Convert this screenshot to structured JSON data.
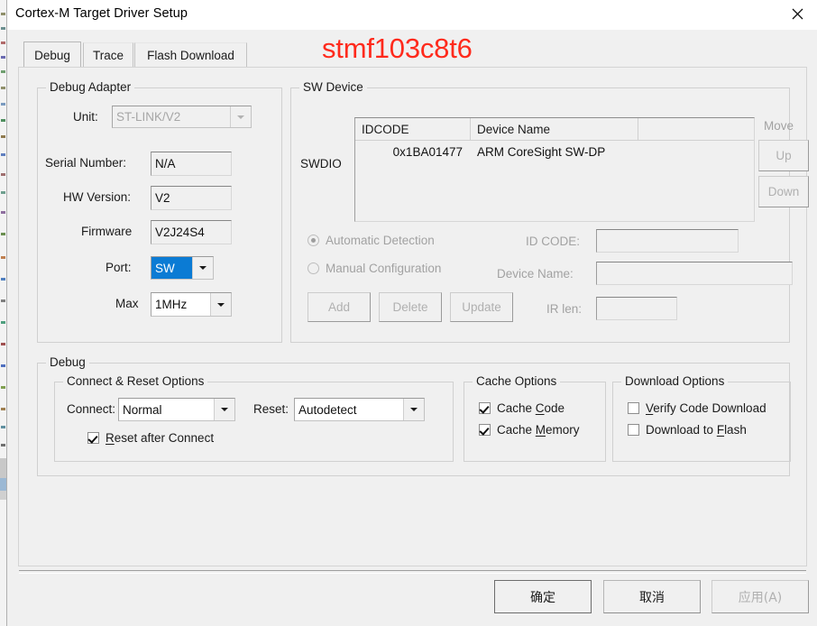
{
  "window": {
    "title": "Cortex-M Target Driver Setup",
    "close_icon": "close-icon"
  },
  "annotation": {
    "text": "stmf103c8t6",
    "color": "#ff2a1c"
  },
  "tabs": [
    {
      "label": "Debug",
      "active": true
    },
    {
      "label": "Trace",
      "active": false
    },
    {
      "label": "Flash Download",
      "active": false
    }
  ],
  "debug_adapter": {
    "group_label": "Debug Adapter",
    "unit": {
      "label": "Unit:",
      "value": "ST-LINK/V2",
      "disabled": true
    },
    "serial_number": {
      "label": "Serial Number:",
      "value": "N/A"
    },
    "hw_version": {
      "label": "HW Version:",
      "value": "V2"
    },
    "firmware": {
      "label": "Firmware",
      "value": "V2J24S4"
    },
    "port": {
      "label": "Port:",
      "value": "SW",
      "selected": true
    },
    "max": {
      "label": "Max",
      "value": "1MHz"
    }
  },
  "sw_device": {
    "group_label": "SW Device",
    "swdio_label": "SWDIO",
    "columns": [
      "IDCODE",
      "Device Name",
      ""
    ],
    "rows": [
      {
        "idcode": "0x1BA01477",
        "device_name": "ARM CoreSight SW-DP",
        "extra": ""
      }
    ],
    "move_label": "Move",
    "up_button": "Up",
    "down_button": "Down",
    "automatic_detection": {
      "label": "Automatic Detection",
      "selected": true
    },
    "manual_configuration": {
      "label": "Manual Configuration",
      "selected": false
    },
    "id_code": {
      "label": "ID CODE:",
      "value": ""
    },
    "device_name": {
      "label": "Device Name:",
      "value": ""
    },
    "ir_len": {
      "label": "IR len:",
      "value": ""
    },
    "add_button": "Add",
    "delete_button": "Delete",
    "update_button": "Update"
  },
  "debug_section": {
    "group_label": "Debug",
    "connect_reset": {
      "group_label": "Connect & Reset Options",
      "connect": {
        "label": "Connect:",
        "value": "Normal"
      },
      "reset": {
        "label": "Reset:",
        "value": "Autodetect"
      },
      "reset_after_connect": {
        "label_pre": "",
        "label_accel": "R",
        "label_post": "eset after Connect",
        "checked": true
      }
    },
    "cache_options": {
      "group_label": "Cache Options",
      "cache_code": {
        "label_pre": "Cache ",
        "label_accel": "C",
        "label_post": "ode",
        "checked": true
      },
      "cache_memory": {
        "label_pre": "Cache ",
        "label_accel": "M",
        "label_post": "emory",
        "checked": true
      }
    },
    "download_options": {
      "group_label": "Download Options",
      "verify_code_download": {
        "label_pre": "",
        "label_accel": "V",
        "label_post": "erify Code Download",
        "checked": false
      },
      "download_to_flash": {
        "label_pre": "Download to ",
        "label_accel": "F",
        "label_post": "lash",
        "checked": false
      }
    }
  },
  "footer": {
    "ok_button": "确定",
    "cancel_button": "取消",
    "apply_button": "应用(A)"
  }
}
